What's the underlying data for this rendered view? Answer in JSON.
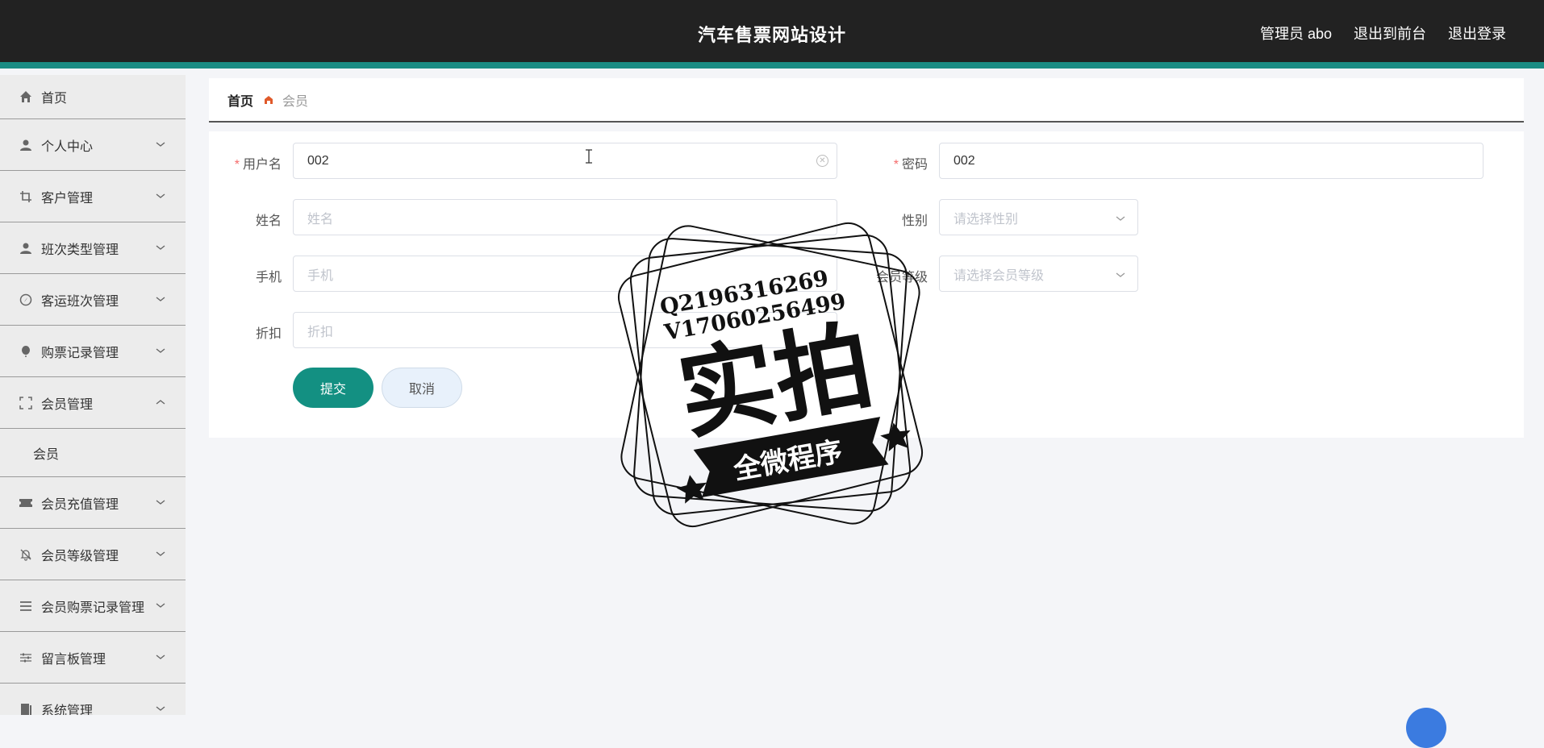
{
  "header": {
    "title": "汽车售票网站设计",
    "admin_label": "管理员 abo",
    "back_to_front": "退出到前台",
    "logout": "退出登录"
  },
  "sidebar": {
    "items": [
      {
        "label": "首页",
        "icon": "home-icon"
      },
      {
        "label": "个人中心",
        "icon": "user-icon"
      },
      {
        "label": "客户管理",
        "icon": "crop-icon"
      },
      {
        "label": "班次类型管理",
        "icon": "user-icon"
      },
      {
        "label": "客运班次管理",
        "icon": "compass-icon"
      },
      {
        "label": "购票记录管理",
        "icon": "balloon-icon"
      },
      {
        "label": "会员管理",
        "icon": "fullscreen-icon",
        "sub": "会员"
      },
      {
        "label": "会员充值管理",
        "icon": "ticket-icon"
      },
      {
        "label": "会员等级管理",
        "icon": "bell-off-icon"
      },
      {
        "label": "会员购票记录管理",
        "icon": "list-icon"
      },
      {
        "label": "留言板管理",
        "icon": "sliders-icon"
      },
      {
        "label": "系统管理",
        "icon": "book-icon"
      }
    ]
  },
  "breadcrumb": {
    "home": "首页",
    "current": "会员"
  },
  "form": {
    "username": {
      "label": "用户名",
      "value": "002"
    },
    "password": {
      "label": "密码",
      "value": "002"
    },
    "name": {
      "label": "姓名",
      "placeholder": "姓名"
    },
    "gender": {
      "label": "性别",
      "placeholder": "请选择性别"
    },
    "phone": {
      "label": "手机",
      "placeholder": "手机"
    },
    "level": {
      "label": "会员等级",
      "placeholder": "请选择会员等级"
    },
    "discount": {
      "label": "折扣",
      "placeholder": "折扣"
    },
    "submit": "提交",
    "cancel": "取消"
  },
  "watermark": {
    "line1": "Q2196316269",
    "line2": "V17060256499",
    "main": "实拍",
    "banner": "全微程序"
  },
  "colors": {
    "topbar": "#222222",
    "accent": "#1b8c84",
    "primary": "#139082"
  }
}
